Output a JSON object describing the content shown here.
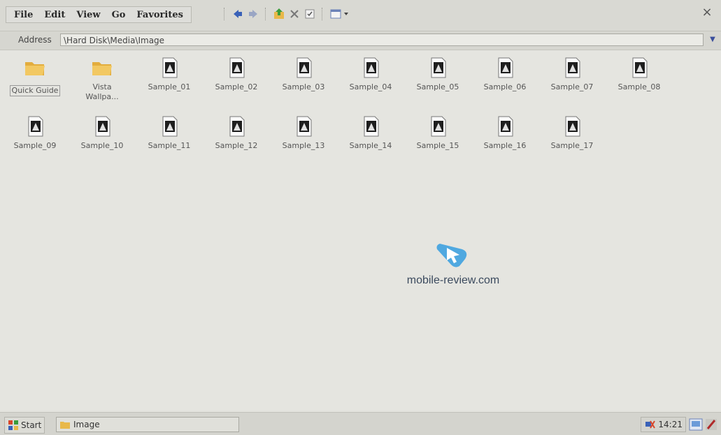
{
  "menu": {
    "items": [
      "File",
      "Edit",
      "View",
      "Go",
      "Favorites"
    ]
  },
  "toolbar": {
    "buttons": [
      "back-arrow-icon",
      "forward-arrow-icon",
      "up-folder-icon",
      "delete-icon",
      "properties-icon",
      "view-menu-icon"
    ]
  },
  "window": {
    "close_glyph": "×"
  },
  "address": {
    "label": "Address",
    "value": "\\Hard Disk\\Media\\Image"
  },
  "files": [
    {
      "name": "Quick Guide",
      "type": "folder"
    },
    {
      "name": "Vista Wallpa...",
      "type": "folder"
    },
    {
      "name": "Sample_01",
      "type": "image"
    },
    {
      "name": "Sample_02",
      "type": "image"
    },
    {
      "name": "Sample_03",
      "type": "image"
    },
    {
      "name": "Sample_04",
      "type": "image"
    },
    {
      "name": "Sample_05",
      "type": "image"
    },
    {
      "name": "Sample_06",
      "type": "image"
    },
    {
      "name": "Sample_07",
      "type": "image"
    },
    {
      "name": "Sample_08",
      "type": "image"
    },
    {
      "name": "Sample_09",
      "type": "image"
    },
    {
      "name": "Sample_10",
      "type": "image"
    },
    {
      "name": "Sample_11",
      "type": "image"
    },
    {
      "name": "Sample_12",
      "type": "image"
    },
    {
      "name": "Sample_13",
      "type": "image"
    },
    {
      "name": "Sample_14",
      "type": "image"
    },
    {
      "name": "Sample_15",
      "type": "image"
    },
    {
      "name": "Sample_16",
      "type": "image"
    },
    {
      "name": "Sample_17",
      "type": "image"
    }
  ],
  "watermark": {
    "text": "mobile-review.com"
  },
  "taskbar": {
    "start_label": "Start",
    "task_label": "Image",
    "clock": "14:21"
  },
  "colors": {
    "folder": "#e8b84a",
    "accent_blue": "#3a62b8",
    "watermark_blue": "#4fa8e0"
  }
}
